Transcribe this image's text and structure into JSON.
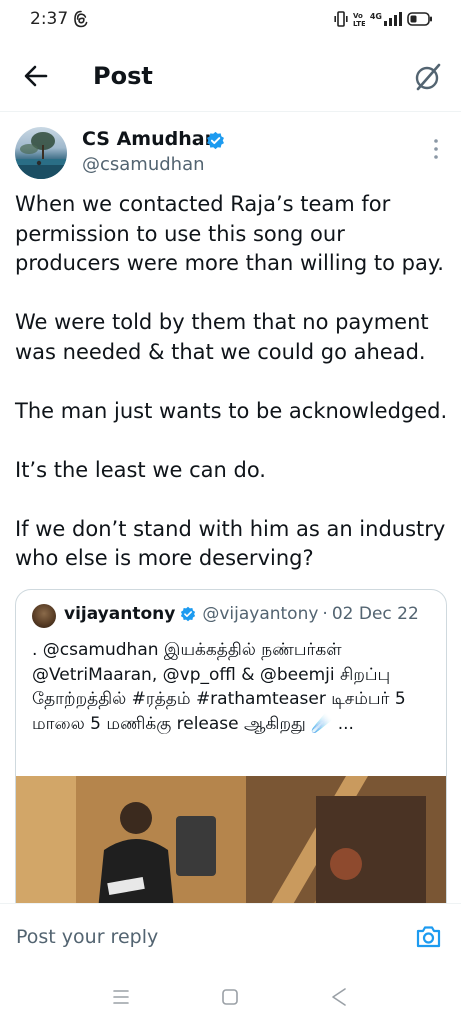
{
  "status_bar": {
    "time": "2:37",
    "network_label": "4G",
    "colors": {
      "text": "#222222"
    }
  },
  "header": {
    "title": "Post",
    "back_icon": "arrow-left-icon",
    "grok_icon": "grok-icon"
  },
  "author": {
    "name": "CS Amudhan",
    "handle": "@csamudhan",
    "verified": true
  },
  "tweet": {
    "text": "When we contacted Raja’s team for permission to use this song our producers were more than willing to pay.\n\nWe were told by them that no payment was needed & that we could go ahead.\n\nThe man just wants to be acknowledged.\n\nIt’s the least we can do.\n\nIf we don’t stand with him as an industry who else is more deserving?"
  },
  "quote": {
    "name": "vijayantony",
    "verified": true,
    "handle": "@vijayantony",
    "dot": "·",
    "date": "02 Dec 22",
    "text": ". @csamudhan இயக்கத்தில் நண்பர்கள் @VetriMaaran, @vp_offl & @beemji சிறப்பு தோற்றத்தில் #ரத்தம் #rathamteaser டிசம்பர் 5 மாலை 5 மணிக்கு release ஆகிறது ☄️ ..."
  },
  "reply": {
    "placeholder": "Post your reply",
    "camera_icon": "camera-icon"
  },
  "nav": {
    "menu_icon": "menu-icon",
    "home_icon": "home-icon",
    "back_icon": "back-triangle-icon"
  },
  "colors": {
    "text_primary": "#0f1419",
    "text_secondary": "#536471",
    "accent_blue": "#1d9bf0",
    "border": "#cfd9de"
  }
}
